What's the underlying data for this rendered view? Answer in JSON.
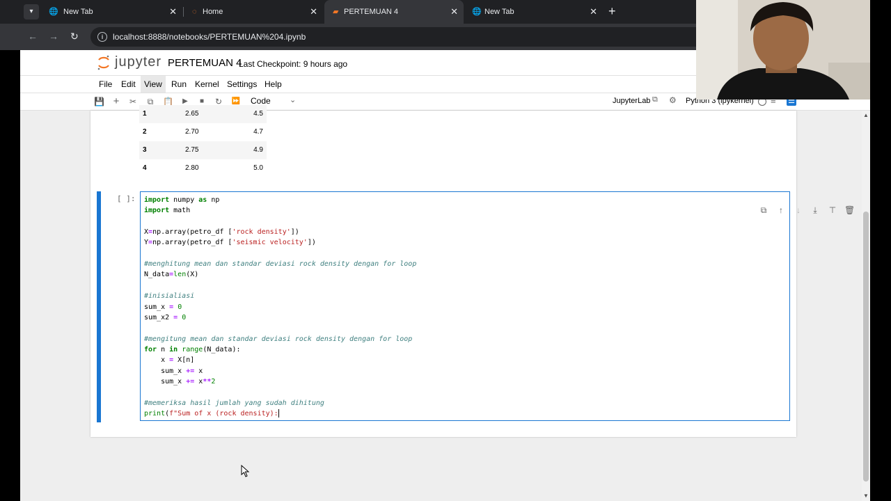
{
  "browser": {
    "tabs": [
      {
        "title": "New Tab",
        "icon": "globe-icon",
        "active": false
      },
      {
        "title": "Home",
        "icon": "jupyter-icon",
        "active": false
      },
      {
        "title": "PERTEMUAN 4",
        "icon": "notebook-icon",
        "active": true
      },
      {
        "title": "New Tab",
        "icon": "globe-icon",
        "active": false
      }
    ],
    "url": "localhost:8888/notebooks/PERTEMUAN%204.ipynb"
  },
  "jupyter": {
    "logo_text": "jupyter",
    "notebook_title": "PERTEMUAN 4",
    "checkpoint": "Last Checkpoint: 9 hours ago",
    "menu": [
      "File",
      "Edit",
      "View",
      "Run",
      "Kernel",
      "Settings",
      "Help"
    ],
    "selected_menu": "View",
    "cell_type": "Code",
    "jupyterlab_link": "JupyterLab",
    "kernel": "Python 3 (ipykernel)"
  },
  "dataframe_rows": [
    {
      "index": "1",
      "rock_density": "2.65",
      "seismic_velocity": "4.5"
    },
    {
      "index": "2",
      "rock_density": "2.70",
      "seismic_velocity": "4.7"
    },
    {
      "index": "3",
      "rock_density": "2.75",
      "seismic_velocity": "4.9"
    },
    {
      "index": "4",
      "rock_density": "2.80",
      "seismic_velocity": "5.0"
    }
  ],
  "cell": {
    "prompt": "[ ]:",
    "code_lines": [
      "import numpy as np",
      "import math",
      "",
      "X=np.array(petro_df ['rock density'])",
      "Y=np.array(petro_df ['seismic velocity'])",
      "",
      "#menghitung mean dan standar deviasi rock density dengan for loop",
      "N_data=len(X)",
      "",
      "#inisialiasi",
      "sum_x = 0",
      "sum_x2 = 0",
      "",
      "#mengitung mean dan standar deviasi rock density dengan for loop",
      "for n in range(N_data):",
      "    x = X[n]",
      "    sum_x += x",
      "    sum_x += x**2",
      "",
      "#memeriksa hasil jumlah yang sudah dihitung",
      "print(f\"Sum of x (rock density):"
    ]
  },
  "colors": {
    "accent": "#1976d2",
    "keyword": "#008000",
    "comment": "#408080",
    "string": "#ba2121",
    "number": "#008000",
    "operator": "#aa22ff"
  }
}
